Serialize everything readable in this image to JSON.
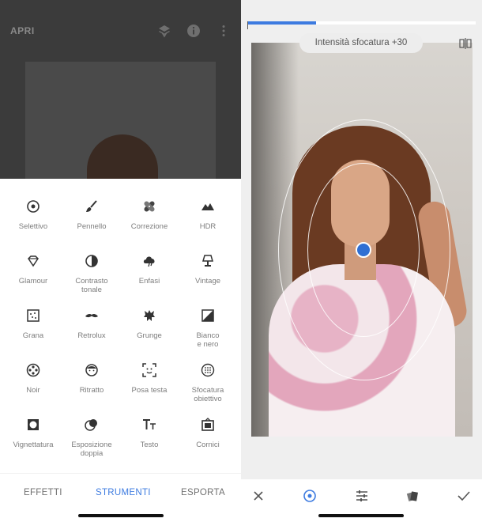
{
  "left_panel": {
    "header": {
      "open_label": "APRI",
      "icons": [
        "layers-icon",
        "info-icon",
        "more-vertical-icon"
      ]
    },
    "tools": [
      {
        "label": "Selettivo",
        "icon": "target-icon"
      },
      {
        "label": "Pennello",
        "icon": "brush-icon"
      },
      {
        "label": "Correzione",
        "icon": "bandage-icon"
      },
      {
        "label": "HDR",
        "icon": "mountains-icon"
      },
      {
        "label": "Glamour",
        "icon": "diamond-icon"
      },
      {
        "label": "Contrasto\ntonale",
        "icon": "half-circle-icon"
      },
      {
        "label": "Enfasi",
        "icon": "cloud-icon"
      },
      {
        "label": "Vintage",
        "icon": "lamp-icon"
      },
      {
        "label": "Grana",
        "icon": "grain-icon"
      },
      {
        "label": "Retrolux",
        "icon": "moustache-icon"
      },
      {
        "label": "Grunge",
        "icon": "grunge-icon"
      },
      {
        "label": "Bianco\ne nero",
        "icon": "black-white-icon"
      },
      {
        "label": "Noir",
        "icon": "film-reel-icon"
      },
      {
        "label": "Ritratto",
        "icon": "face-icon"
      },
      {
        "label": "Posa testa",
        "icon": "face-frame-icon"
      },
      {
        "label": "Sfocatura\nobiettivo",
        "icon": "lens-blur-icon"
      },
      {
        "label": "Vignettatura",
        "icon": "vignette-icon"
      },
      {
        "label": "Esposizione\ndoppia",
        "icon": "double-exposure-icon"
      },
      {
        "label": "Testo",
        "icon": "text-icon"
      },
      {
        "label": "Cornici",
        "icon": "frame-icon"
      }
    ],
    "bottom_tabs": [
      {
        "label": "EFFETTI",
        "active": false
      },
      {
        "label": "STRUMENTI",
        "active": true
      },
      {
        "label": "ESPORTA",
        "active": false
      }
    ]
  },
  "right_panel": {
    "progress": 0.3,
    "adjustment_label": "Intensità sfocatura +30",
    "bottom_icons": [
      "close-icon",
      "target-icon",
      "sliders-icon",
      "style-icon",
      "check-icon"
    ]
  },
  "colors": {
    "accent": "#3d7be0",
    "pin": "#2f6fd3",
    "dim_overlay": "#3b3b3b"
  }
}
